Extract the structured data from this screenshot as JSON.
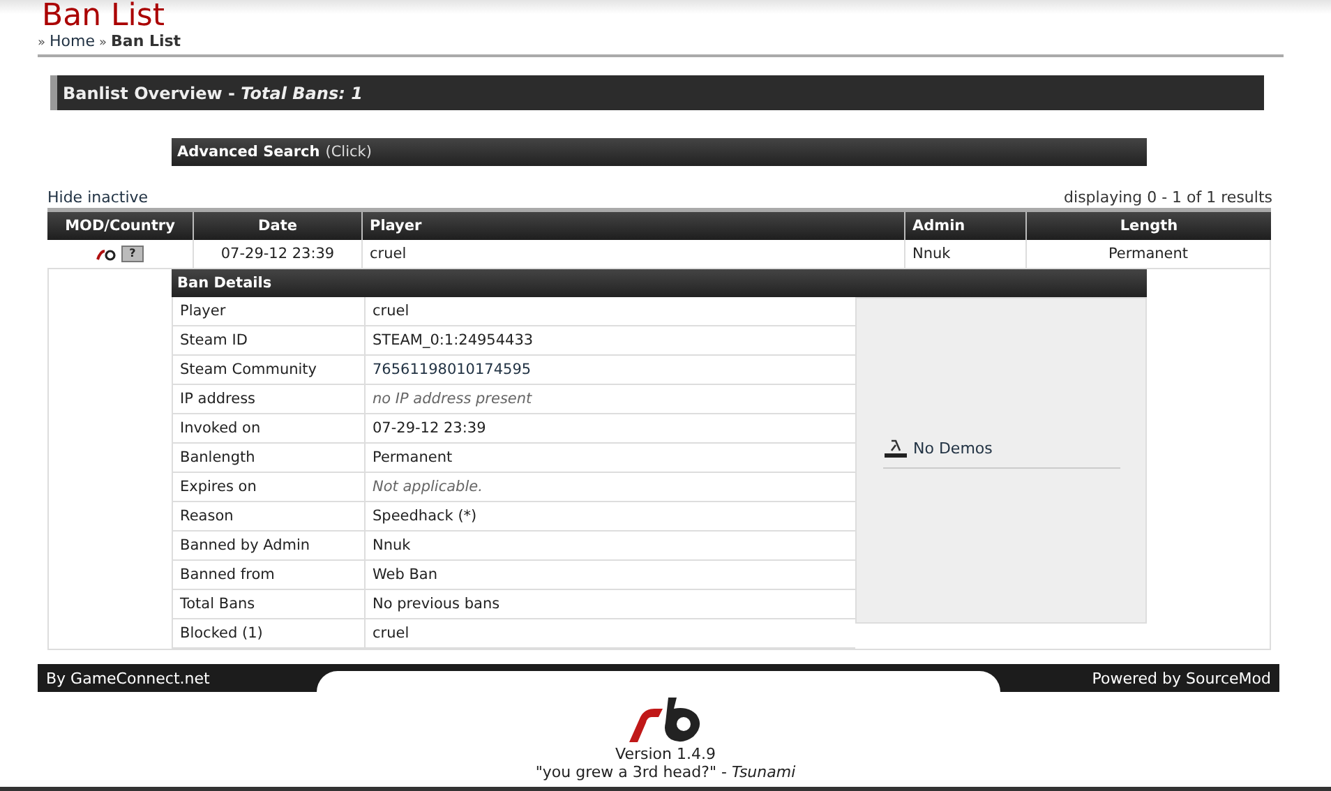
{
  "header": {
    "title": "Ban List",
    "breadcrumb": [
      {
        "separator": "»",
        "label": "Home",
        "kind": "link"
      },
      {
        "separator": "»",
        "label": "Ban List",
        "kind": "current"
      }
    ]
  },
  "overview": {
    "title": "Banlist Overview",
    "separator": "-",
    "subtitle": "Total Bans: 1"
  },
  "advanced_search": {
    "title": "Advanced Search",
    "hint": "(Click)"
  },
  "hide_inactive": "Hide inactive",
  "results_info": "displaying 0 - 1 of 1 results",
  "table": {
    "columns": [
      {
        "label": "MOD/Country"
      },
      {
        "label": "Date"
      },
      {
        "label": "Player"
      },
      {
        "label": "Admin"
      },
      {
        "label": "Length"
      }
    ],
    "rows": [
      {
        "country": "?",
        "date": "07-29-12 23:39",
        "player": "cruel",
        "admin": "Nnuk",
        "length": "Permanent",
        "expanded": true
      }
    ]
  },
  "ban_details": {
    "title": "Ban Details",
    "rows": [
      {
        "label": "Player",
        "value": "cruel",
        "kind": "text"
      },
      {
        "label": "Steam ID",
        "value": "STEAM_0:1:24954433",
        "kind": "text"
      },
      {
        "label": "Steam Community",
        "value": "76561198010174595",
        "kind": "link"
      },
      {
        "label": "IP address",
        "value": "no IP address present",
        "kind": "note"
      },
      {
        "label": "Invoked on",
        "value": "07-29-12 23:39",
        "kind": "text"
      },
      {
        "label": "Banlength",
        "value": "Permanent",
        "kind": "text"
      },
      {
        "label": "Expires on",
        "value": "Not applicable.",
        "kind": "note"
      },
      {
        "label": "Reason",
        "value": "Speedhack (*)",
        "kind": "text"
      },
      {
        "label": "Banned by Admin",
        "value": "Nnuk",
        "kind": "text"
      },
      {
        "label": "Banned from",
        "value": "Web Ban",
        "kind": "text"
      },
      {
        "label": "Total Bans",
        "value": "No previous bans",
        "kind": "text"
      },
      {
        "label": "Blocked (1)",
        "value": "cruel",
        "kind": "text"
      }
    ],
    "demos": "No Demos"
  },
  "footer": {
    "left": "By GameConnect.net",
    "right": "Powered by SourceMod",
    "version": "Version 1.4.9",
    "quote": "\"you grew a 3rd head?\" - ",
    "quote_author": "Tsunami"
  }
}
